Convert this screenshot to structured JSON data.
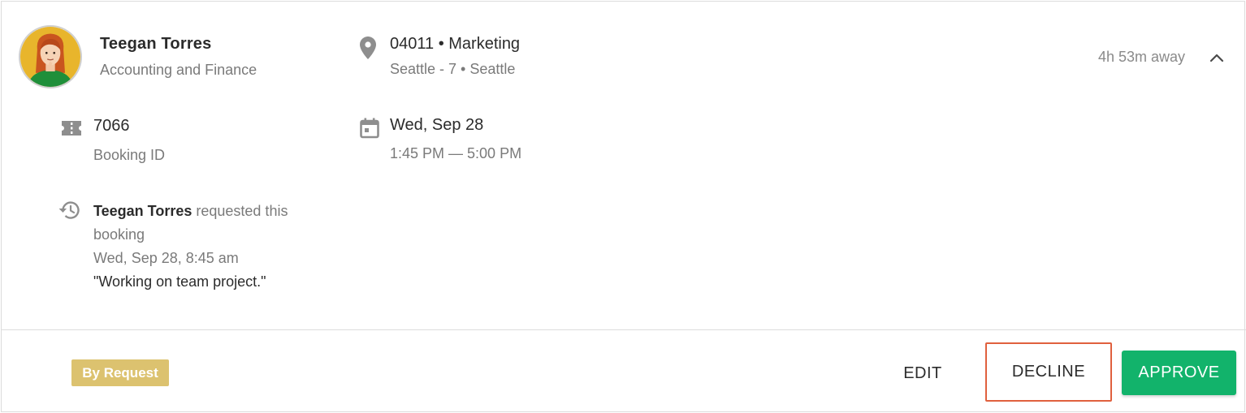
{
  "person": {
    "name": "Teegan Torres",
    "department": "Accounting and Finance"
  },
  "location": {
    "title": "04011 • Marketing",
    "subtitle": "Seattle - 7 • Seattle"
  },
  "status": {
    "away": "4h 53m away"
  },
  "booking": {
    "id": "7066",
    "id_label": "Booking ID",
    "date": "Wed, Sep 28",
    "time": "1:45 PM — 5:00 PM"
  },
  "history": {
    "requester": "Teegan Torres",
    "action": " requested this booking",
    "timestamp": "Wed, Sep 28, 8:45 am",
    "note": "\"Working on team project.\""
  },
  "footer": {
    "badge": "By Request",
    "edit_label": "EDIT",
    "decline_label": "DECLINE",
    "approve_label": "APPROVE"
  },
  "colors": {
    "approve": "#12b36b",
    "badge": "#dcc26f",
    "highlight_border": "#e0603e",
    "icon_gray": "#8e8e8e"
  },
  "icons": {
    "location": "map-pin-icon",
    "collapse": "chevron-up-icon",
    "booking": "ticket-icon",
    "date": "calendar-icon",
    "history": "history-icon"
  }
}
